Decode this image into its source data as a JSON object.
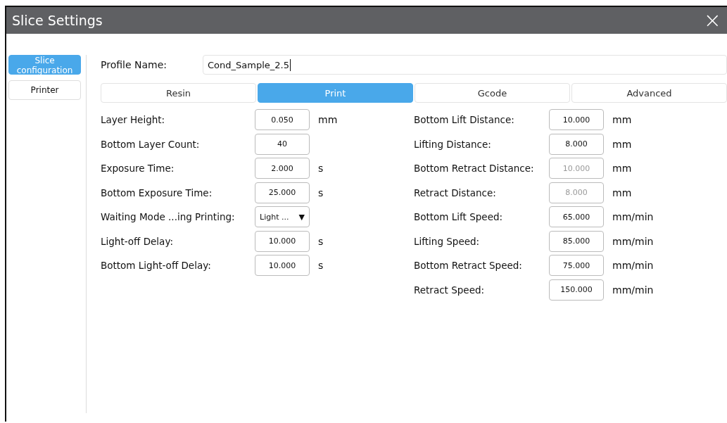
{
  "window": {
    "title": "Slice Settings",
    "close": "×"
  },
  "sidebar": {
    "items": [
      {
        "label": "Slice configuration",
        "selected": true
      },
      {
        "label": "Printer",
        "selected": false
      }
    ]
  },
  "profile": {
    "label": "Profile Name:",
    "value": "Cond_Sample_2.5"
  },
  "tabs": [
    {
      "label": "Resin",
      "selected": false
    },
    {
      "label": "Print",
      "selected": true
    },
    {
      "label": "Gcode",
      "selected": false
    },
    {
      "label": "Advanced",
      "selected": false
    }
  ],
  "left_fields": [
    {
      "kind": "field",
      "label": "Layer Height:",
      "value": "0.050",
      "unit": "mm",
      "disabled": false
    },
    {
      "kind": "field",
      "label": "Bottom Layer Count:",
      "value": "40",
      "disabled": false
    },
    {
      "kind": "field",
      "label": "Exposure Time:",
      "value": "2.000",
      "unit": "s",
      "disabled": false
    },
    {
      "kind": "field",
      "label": "Bottom Exposure Time:",
      "value": "25.000",
      "unit": "s",
      "disabled": false
    },
    {
      "kind": "dropdown",
      "label": "Waiting Mode ...ing Printing:",
      "value": "Light ...",
      "arrow": "▼",
      "disabled": false
    },
    {
      "kind": "field",
      "label": "Light-off Delay:",
      "value": "10.000",
      "unit": "s",
      "disabled": false
    },
    {
      "kind": "field",
      "label": "Bottom Light-off Delay:",
      "value": "10.000",
      "unit": "s",
      "disabled": false
    }
  ],
  "right_fields": [
    {
      "kind": "field",
      "label": "Bottom Lift Distance:",
      "value": "10.000",
      "unit": "mm",
      "disabled": false
    },
    {
      "kind": "field",
      "label": "Lifting Distance:",
      "value": "8.000",
      "unit": "mm",
      "disabled": false
    },
    {
      "kind": "field",
      "label": "Bottom Retract Distance:",
      "value": "10.000",
      "unit": "mm",
      "disabled": true
    },
    {
      "kind": "field",
      "label": "Retract Distance:",
      "value": "8.000",
      "unit": "mm",
      "disabled": true
    },
    {
      "kind": "field",
      "label": "Bottom Lift Speed:",
      "value": "65.000",
      "unit": "mm/min",
      "disabled": false
    },
    {
      "kind": "field",
      "label": "Lifting Speed:",
      "value": "85.000",
      "unit": "mm/min",
      "disabled": false
    },
    {
      "kind": "field",
      "label": "Bottom Retract Speed:",
      "value": "75.000",
      "unit": "mm/min",
      "disabled": false
    },
    {
      "kind": "field",
      "label": "Retract Speed:",
      "value": "150.000",
      "unit": "mm/min",
      "disabled": false
    }
  ]
}
